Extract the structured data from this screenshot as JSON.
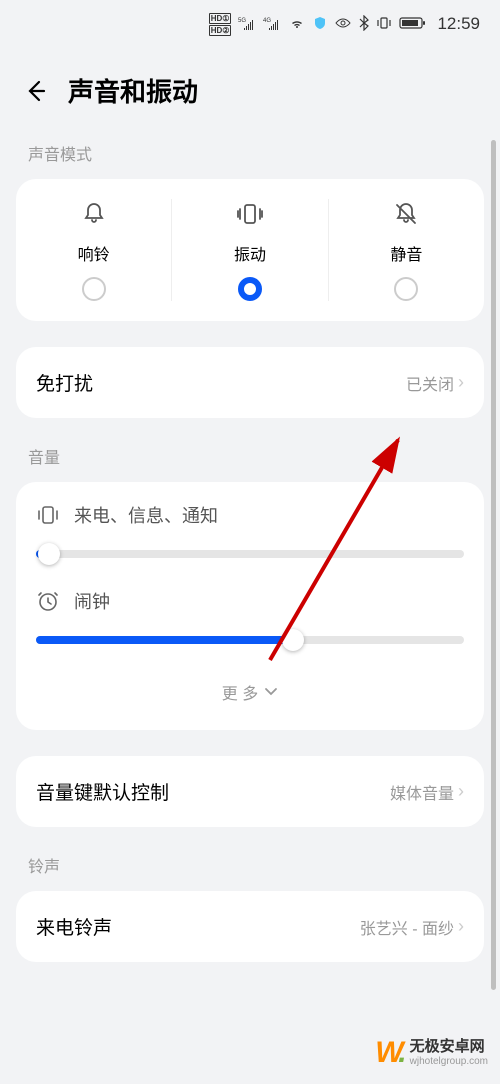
{
  "status_bar": {
    "time": "12:59"
  },
  "header": {
    "title": "声音和振动"
  },
  "sound_mode": {
    "section_label": "声音模式",
    "options": [
      {
        "label": "响铃",
        "selected": false
      },
      {
        "label": "振动",
        "selected": true
      },
      {
        "label": "静音",
        "selected": false
      }
    ]
  },
  "dnd": {
    "title": "免打扰",
    "value": "已关闭"
  },
  "volume": {
    "section_label": "音量",
    "ringtone_label": "来电、信息、通知",
    "ringtone_percent": 3,
    "alarm_label": "闹钟",
    "alarm_percent": 60,
    "more_label": "更 多"
  },
  "volume_key": {
    "title": "音量键默认控制",
    "value": "媒体音量"
  },
  "ringtone": {
    "section_label": "铃声",
    "incoming_title": "来电铃声",
    "incoming_value": "张艺兴 - 面纱"
  },
  "watermark": {
    "main": "无极安卓网",
    "sub": "wjhotelgroup.com"
  }
}
